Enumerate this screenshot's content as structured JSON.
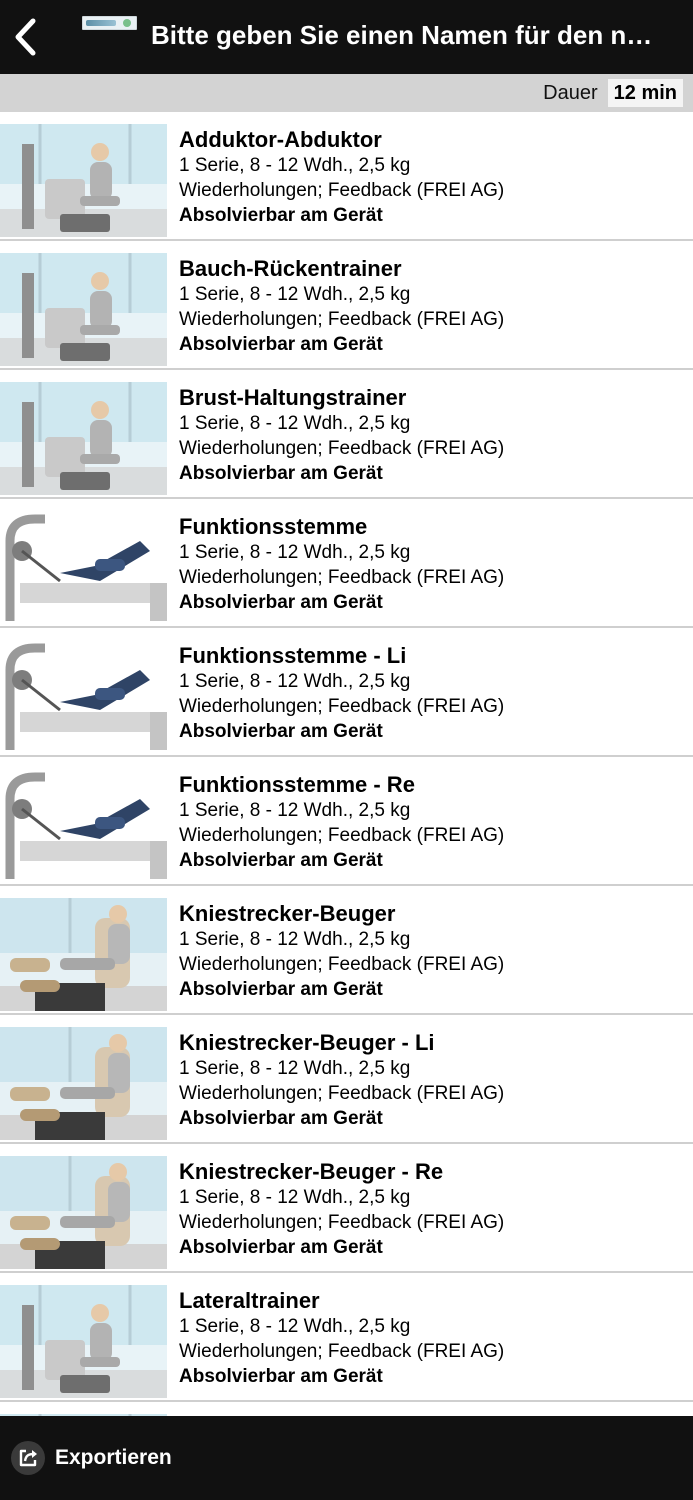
{
  "header": {
    "title": "Bitte geben Sie einen Namen für den n…",
    "back_icon": "chevron-left-icon"
  },
  "duration": {
    "label": "Dauer",
    "value": "12 min"
  },
  "exercises": [
    {
      "name": "Adduktor-Abduktor",
      "line1": "1 Serie, 8 - 12 Wdh., 2,5 kg",
      "line2": "Wiederholungen; Feedback (FREI AG)",
      "note": "Absolvierbar am Gerät",
      "image": "seated-machine"
    },
    {
      "name": "Bauch-Rückentrainer",
      "line1": "1 Serie, 8 - 12 Wdh., 2,5 kg",
      "line2": "Wiederholungen; Feedback (FREI AG)",
      "note": "Absolvierbar am Gerät",
      "image": "seated-machine"
    },
    {
      "name": "Brust-Haltungstrainer",
      "line1": "1 Serie, 8 - 12 Wdh., 2,5 kg",
      "line2": "Wiederholungen; Feedback (FREI AG)",
      "note": "Absolvierbar am Gerät",
      "image": "seated-machine"
    },
    {
      "name": "Funktionsstemme",
      "line1": "1 Serie, 8 - 12 Wdh., 2,5 kg",
      "line2": "Wiederholungen; Feedback (FREI AG)",
      "note": "Absolvierbar am Gerät",
      "image": "leg-press"
    },
    {
      "name": "Funktionsstemme - Li",
      "line1": "1 Serie, 8 - 12 Wdh., 2,5 kg",
      "line2": "Wiederholungen; Feedback (FREI AG)",
      "note": "Absolvierbar am Gerät",
      "image": "leg-press"
    },
    {
      "name": "Funktionsstemme - Re",
      "line1": "1 Serie, 8 - 12 Wdh., 2,5 kg",
      "line2": "Wiederholungen; Feedback (FREI AG)",
      "note": "Absolvierbar am Gerät",
      "image": "leg-press"
    },
    {
      "name": "Kniestrecker-Beuger",
      "line1": "1 Serie, 8 - 12 Wdh., 2,5 kg",
      "line2": "Wiederholungen; Feedback (FREI AG)",
      "note": "Absolvierbar am Gerät",
      "image": "knee-machine"
    },
    {
      "name": "Kniestrecker-Beuger - Li",
      "line1": "1 Serie, 8 - 12 Wdh., 2,5 kg",
      "line2": "Wiederholungen; Feedback (FREI AG)",
      "note": "Absolvierbar am Gerät",
      "image": "knee-machine"
    },
    {
      "name": "Kniestrecker-Beuger - Re",
      "line1": "1 Serie, 8 - 12 Wdh., 2,5 kg",
      "line2": "Wiederholungen; Feedback (FREI AG)",
      "note": "Absolvierbar am Gerät",
      "image": "knee-machine"
    },
    {
      "name": "Lateraltrainer",
      "line1": "1 Serie, 8 - 12 Wdh., 2,5 kg",
      "line2": "Wiederholungen; Feedback (FREI AG)",
      "note": "Absolvierbar am Gerät",
      "image": "seated-machine"
    },
    {
      "name": "",
      "line1": "",
      "line2": "",
      "note": "",
      "image": "seated-machine"
    }
  ],
  "footer": {
    "export_label": "Exportieren",
    "export_icon": "share-export-icon"
  }
}
